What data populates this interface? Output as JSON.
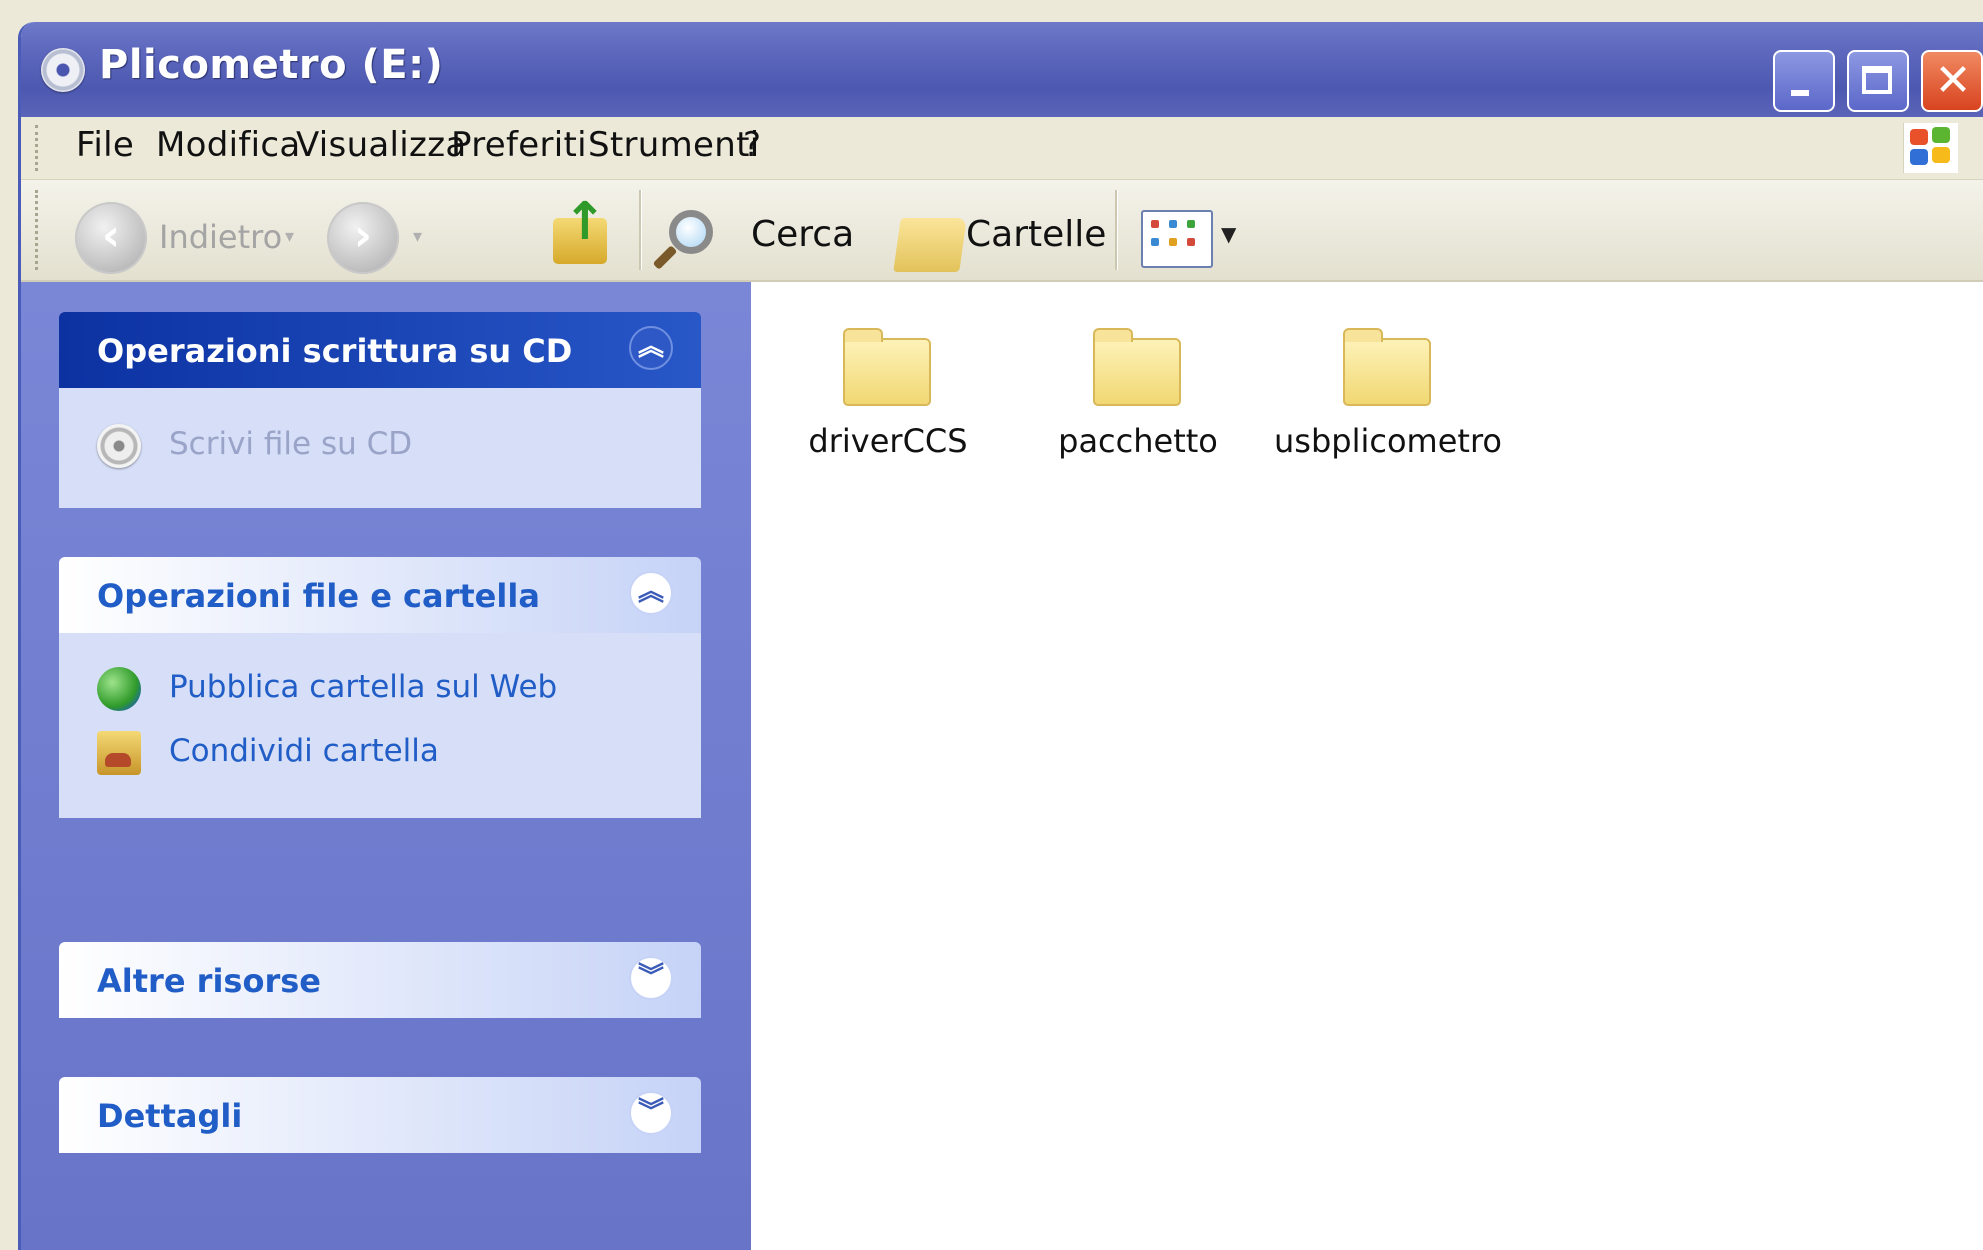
{
  "window": {
    "title": "Plicometro (E:)",
    "title_icon": "cd-drive-icon",
    "controls": [
      "minimize",
      "maximize",
      "close"
    ],
    "close_glyph": "✕"
  },
  "menu": {
    "items": [
      "File",
      "Modifica",
      "Visualizza",
      "Preferiti",
      "Strumenti",
      "?"
    ]
  },
  "toolbar": {
    "back_label": "Indietro",
    "search_label": "Cerca",
    "folders_label": "Cartelle"
  },
  "taskpane": {
    "cd_tasks": {
      "title": "Operazioni scrittura su CD",
      "items": [
        {
          "label": "Scrivi file su CD",
          "icon": "cd-write-icon"
        }
      ]
    },
    "file_tasks": {
      "title": "Operazioni file e cartella",
      "items": [
        {
          "label": "Pubblica cartella sul Web",
          "icon": "globe-icon"
        },
        {
          "label": "Condividi cartella",
          "icon": "share-folder-icon"
        }
      ]
    },
    "other_places": {
      "title": "Altre risorse"
    },
    "details": {
      "title": "Dettagli"
    }
  },
  "content": {
    "folders": [
      "driverCCS",
      "pacchetto",
      "usbplicometro"
    ]
  },
  "colors": {
    "titlebar": "#5b66bc",
    "taskpane_bg": "#7a86d6",
    "task_link": "#215dc6",
    "folder_yellow": "#f1d873"
  }
}
